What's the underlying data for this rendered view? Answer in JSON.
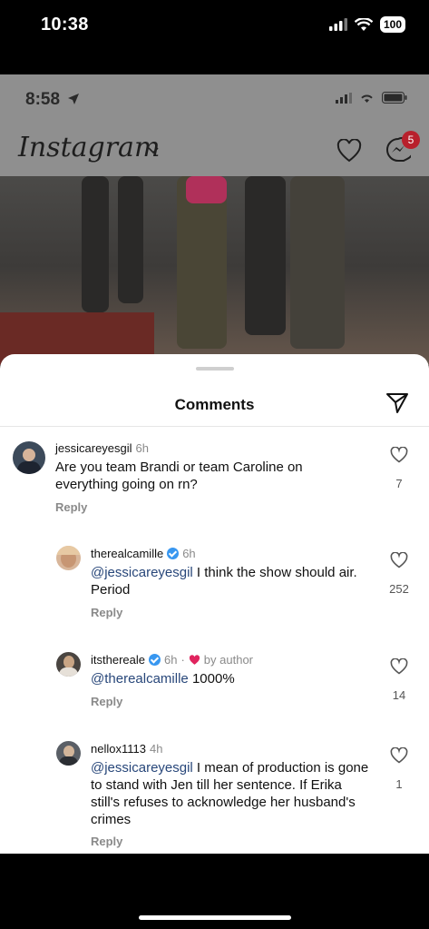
{
  "status_bar": {
    "time": "10:38",
    "battery": "100"
  },
  "inner": {
    "time": "8:58",
    "logo": "Instagram",
    "messages_badge": "5"
  },
  "sheet": {
    "title": "Comments"
  },
  "comments": [
    {
      "user": "jessicareyesgil",
      "time": "6h",
      "mention": "",
      "text": "Are you team Brandi or team Caroline on everything going on rn?",
      "reply": "Reply",
      "likes": "7"
    },
    {
      "user": "therealcamille",
      "time": "6h",
      "mention": "@jessicareyesgil",
      "text": " I think the show should air. Period",
      "reply": "Reply",
      "likes": "252"
    },
    {
      "user": "itsthereale",
      "time": "6h",
      "liked_by": "by author",
      "mention": "@therealcamille",
      "text": " 1000%",
      "reply": "Reply",
      "likes": "14"
    },
    {
      "user": "nellox1113",
      "time": "4h",
      "mention": "@jessicareyesgil",
      "text": " I mean of production is gone to stand with Jen till her sentence. If Erika still's refuses to acknowledge her husband's crimes",
      "reply": "Reply",
      "likes": "1"
    }
  ],
  "colors": {
    "mention": "#28477a",
    "verified": "#3897f0",
    "heart_red": "#e0245e"
  }
}
